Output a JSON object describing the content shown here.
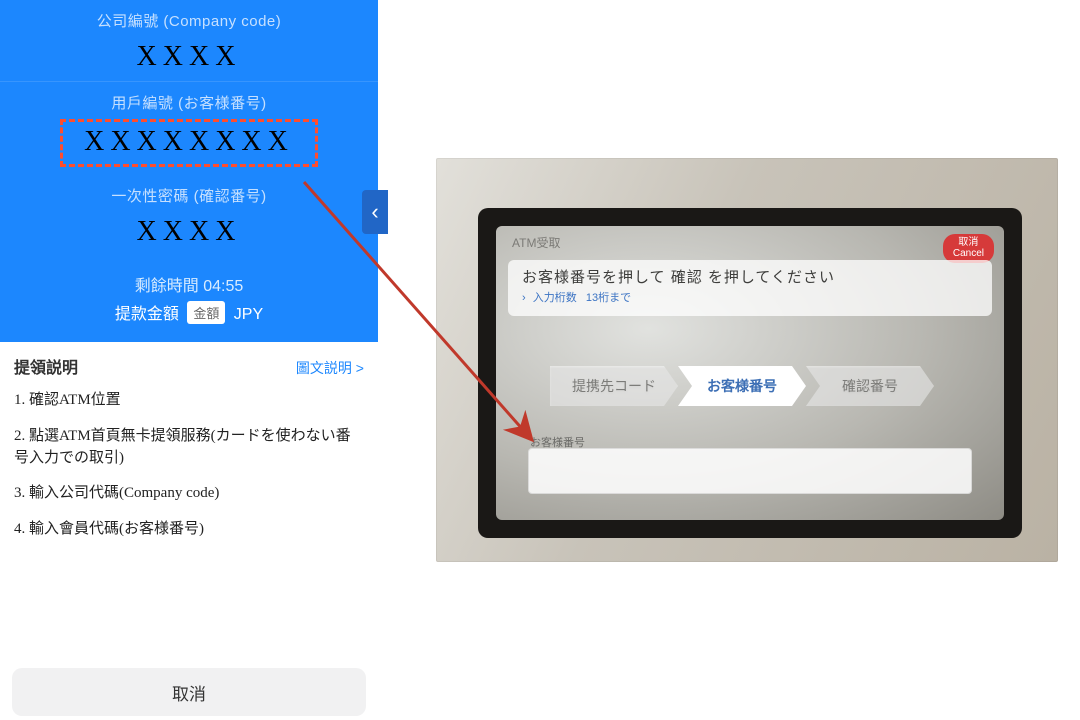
{
  "phone": {
    "company": {
      "label": "公司編號 (Company code)",
      "value": "XXXX"
    },
    "customer": {
      "label": "用戶編號 (お客様番号)",
      "value": "XXXXXXXX"
    },
    "otp": {
      "label": "一次性密碼 (確認番号)",
      "value": "XXXX"
    },
    "timer_label": "剩餘時間 04:55",
    "amount_label": "提款金額",
    "amount_box": "金額",
    "currency": "JPY",
    "chevron": "‹"
  },
  "instructions": {
    "title": "提領説明",
    "link": "圖文説明 >",
    "steps": [
      "1. 確認ATM位置",
      "2. 點選ATM首頁無卡提領服務(カードを使わない番号入力での取引)",
      "3. 輸入公司代碼(Company code)",
      "4. 輸入會員代碼(お客様番号)"
    ],
    "cancel": "取消"
  },
  "atm": {
    "screen_title": "ATM受取",
    "cancel_jp": "取消",
    "cancel_en": "Cancel",
    "prompt": "お客様番号を押して 確認 を押してください",
    "hint_label": "入力桁数",
    "hint_value": "13桁まで",
    "steps": [
      "提携先コード",
      "お客様番号",
      "確認番号"
    ],
    "field_label": "お客様番号"
  }
}
